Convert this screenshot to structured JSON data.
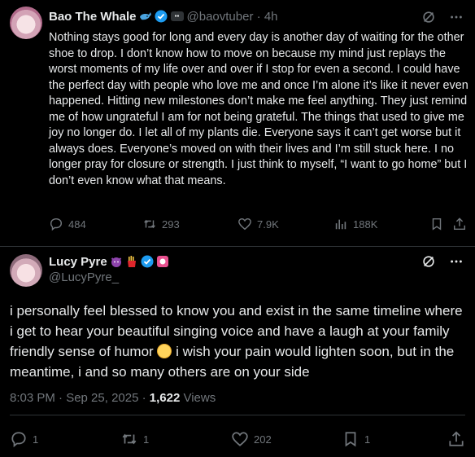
{
  "tweet": {
    "author": {
      "name": "Bao The Whale",
      "handle": "@baovtuber",
      "time": "4h",
      "emoji_badge": "whale-emoji"
    },
    "text": "Nothing stays good for long and every day is another day of waiting for the other shoe to drop. I don’t know how to move on because my mind just replays the worst moments of my life over and over if I stop for even a second. I could have the perfect day with people who love me and once I’m alone it’s like it never even happened. Hitting new milestones don’t make me feel anything. They just remind me of how ungrateful I am for not being grateful. The things that used to give me joy no longer do. I let all of my plants die. Everyone says it can’t get worse but it always does. Everyone’s moved on with their lives and I’m still stuck here. I no longer pray for closure or strength. I just think to myself, “I want to go home” but I don’t even know what that means.",
    "replies": "484",
    "reposts": "293",
    "likes": "7.9K",
    "views": "188K"
  },
  "reply": {
    "author": {
      "name": "Lucy Pyre",
      "handle": "@LucyPyre_"
    },
    "text_part1": "i personally feel blessed to know you and exist in the same timeline where i get to hear your beautiful singing voice and have a laugh at your family friendly sense of humor ",
    "text_part2": " i wish your pain would lighten soon, but in the meantime, i and so many others are on your side",
    "timestamp": "8:03 PM · Sep 25, 2025 · ",
    "views_count": "1,622",
    "views_label": " Views",
    "replies": "1",
    "reposts": "1",
    "likes": "202",
    "bookmarks": "1"
  },
  "colors": {
    "background": "#000000",
    "text": "#e7e9ea",
    "muted": "#71767b",
    "verified": "#1d9bf0",
    "divider": "#2f3336"
  }
}
